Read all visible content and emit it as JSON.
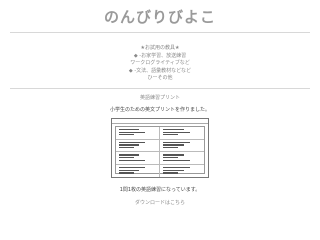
{
  "site": {
    "title": "のんびりびよこ"
  },
  "menu": {
    "items": [
      {
        "label": "★お試用の教具★"
      },
      {
        "label": "◆ -お家学習、放送練習"
      },
      {
        "label": "ワークログライティブなど"
      },
      {
        "label": "◆ -文法、語彙教材などなど"
      },
      {
        "label": "ひーその他"
      }
    ]
  },
  "section": {
    "title": "英語練習プリント",
    "intro": "小学生のための英文プリントを作りました。",
    "preview_header": {
      "left": "",
      "right": ""
    },
    "caption": "1問1枚の英語練習になっています。",
    "download_label": "ダウンロードはこちら"
  }
}
